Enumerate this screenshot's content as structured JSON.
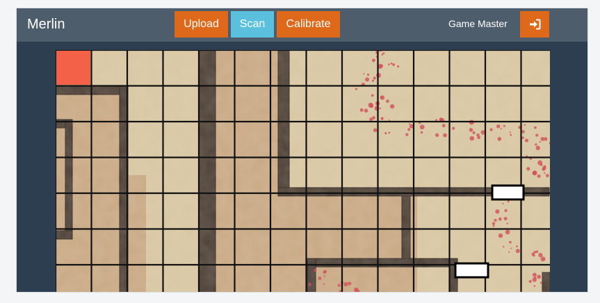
{
  "app": {
    "brand": "Merlin"
  },
  "toolbar": {
    "upload_label": "Upload",
    "scan_label": "Scan",
    "calibrate_label": "Calibrate"
  },
  "user": {
    "role": "Game Master",
    "signin_icon": "sign-in-icon"
  },
  "colors": {
    "navbar": "#4e5d6c",
    "background": "#2c3e50",
    "accent": "#df691a",
    "info": "#5bc0de",
    "floor": "#d9c7a3",
    "wall": "#4b3f37",
    "highlight": "#f36149",
    "blood": "#d2505a"
  }
}
